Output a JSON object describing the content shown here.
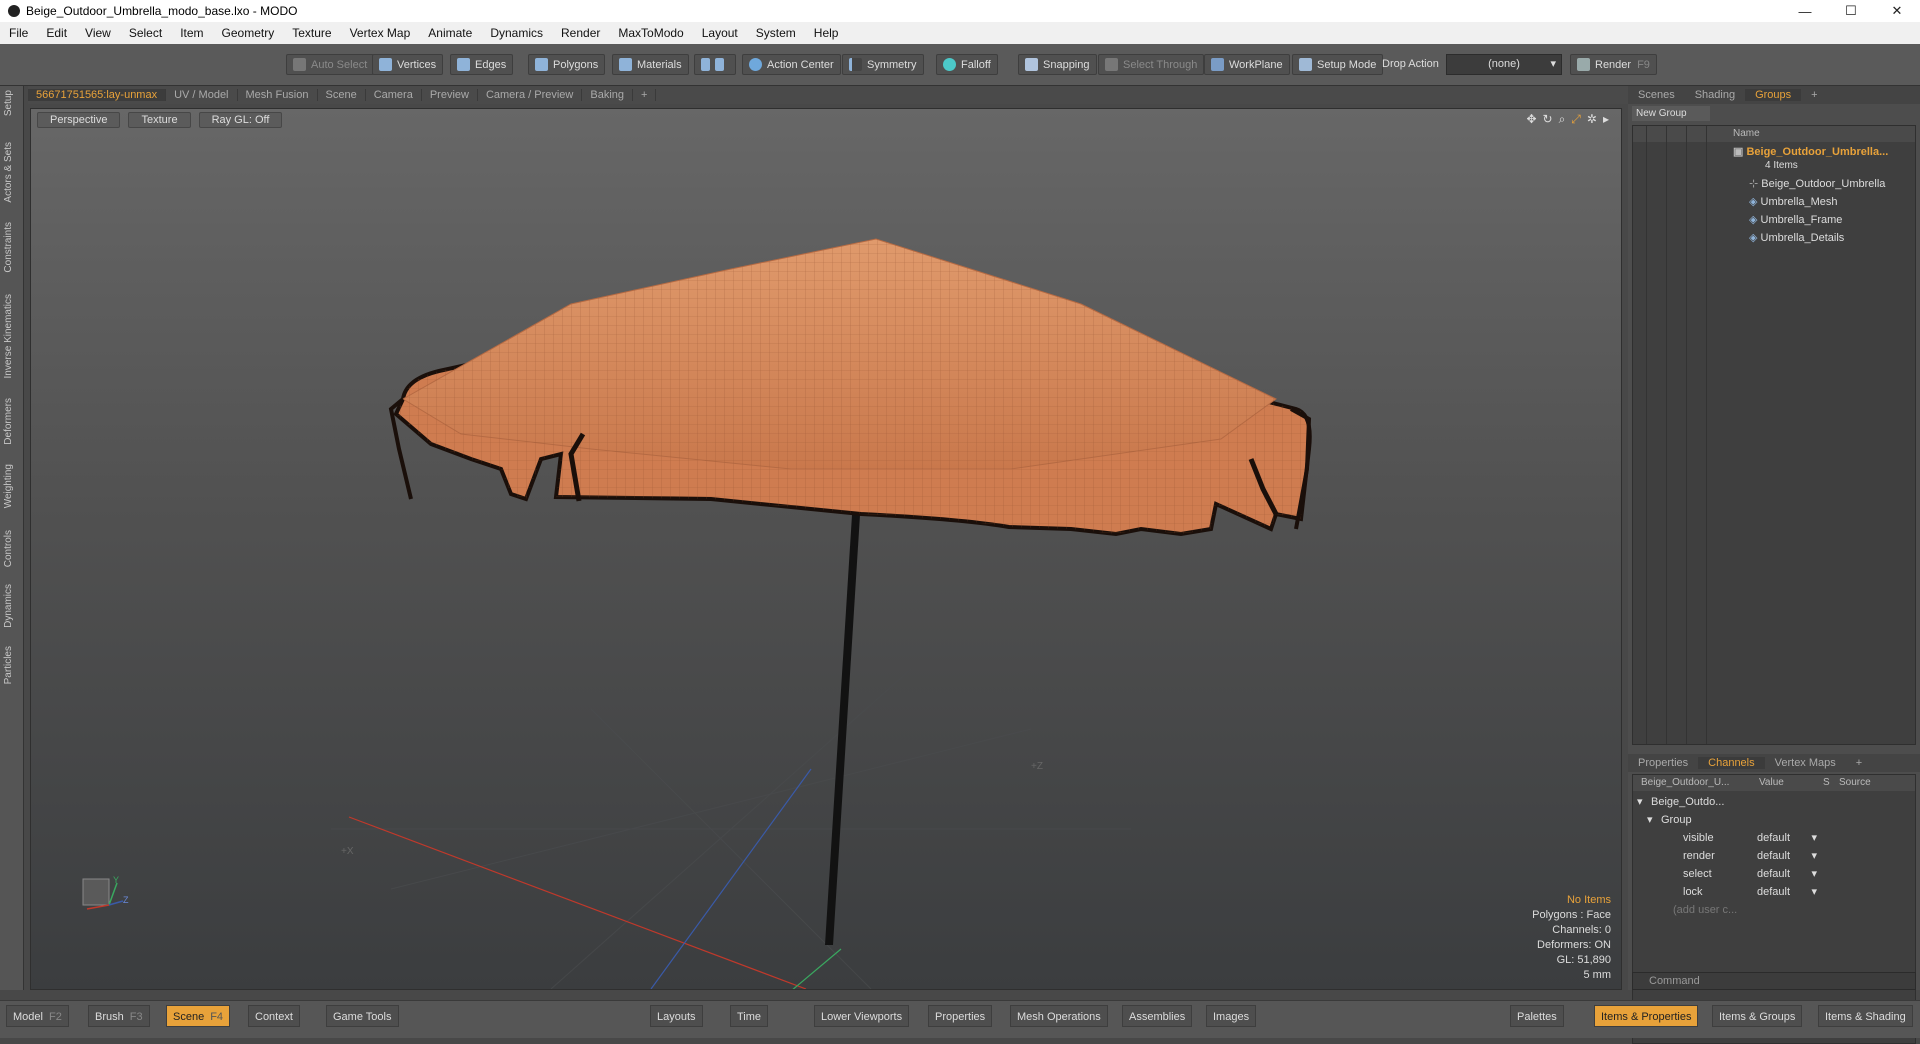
{
  "window": {
    "title": "Beige_Outdoor_Umbrella_modo_base.lxo - MODO",
    "min": "—",
    "max": "☐",
    "close": "✕"
  },
  "menu": [
    "File",
    "Edit",
    "View",
    "Select",
    "Item",
    "Geometry",
    "Texture",
    "Vertex Map",
    "Animate",
    "Dynamics",
    "Render",
    "MaxToModo",
    "Layout",
    "System",
    "Help"
  ],
  "toolbar": {
    "auto_select": "Auto Select",
    "vertices": "Vertices",
    "edges": "Edges",
    "polygons": "Polygons",
    "materials": "Materials",
    "action_center": "Action Center",
    "symmetry": "Symmetry",
    "falloff": "Falloff",
    "snapping": "Snapping",
    "select_through": "Select Through",
    "workplane": "WorkPlane",
    "setup_mode": "Setup Mode",
    "drop_action": "Drop Action",
    "drop_value": "(none)",
    "render": "Render",
    "render_key": "F9"
  },
  "left_tabs": [
    "Setup",
    "Actors & Sets",
    "Constraints",
    "Inverse Kinematics",
    "Deformers",
    "Weighting",
    "Controls",
    "Dynamics",
    "Particles"
  ],
  "viewport_tabs": [
    "56671751565:lay-unmax",
    "UV / Model",
    "Mesh Fusion",
    "Scene",
    "Camera",
    "Preview",
    "Camera / Preview",
    "Baking",
    "+"
  ],
  "viewport": {
    "view_mode": "Perspective",
    "shading": "Texture",
    "raygl": "Ray GL: Off",
    "axis_x": "+X",
    "axis_z": "+Z",
    "gizmo_y": "Y",
    "gizmo_z": "Z",
    "info": {
      "items": "No Items",
      "polygons": "Polygons : Face",
      "channels": "Channels: 0",
      "deformers": "Deformers: ON",
      "gl": "GL: 51,890",
      "unit": "5 mm"
    }
  },
  "scene_tabs": [
    "Scenes",
    "Shading",
    "Groups",
    "+"
  ],
  "groups": {
    "new_group": "New Group",
    "column_name": "Name",
    "root": "Beige_Outdoor_Umbrella...",
    "root_count": "4 Items",
    "children": [
      "Beige_Outdoor_Umbrella",
      "Umbrella_Mesh",
      "Umbrella_Frame",
      "Umbrella_Details"
    ]
  },
  "prop_tabs": [
    "Properties",
    "Channels",
    "Vertex Maps",
    "+"
  ],
  "channels": {
    "col_item": "Beige_Outdoor_U...",
    "col_value": "Value",
    "col_s": "S",
    "col_source": "Source",
    "item": "Beige_Outdo...",
    "group": "Group",
    "rows": [
      {
        "name": "visible",
        "value": "default"
      },
      {
        "name": "render",
        "value": "default"
      },
      {
        "name": "select",
        "value": "default"
      },
      {
        "name": "lock",
        "value": "default"
      }
    ],
    "add_user": "(add user c..."
  },
  "command_placeholder": "Command",
  "statusbar": {
    "model": "Model",
    "model_key": "F2",
    "brush": "Brush",
    "brush_key": "F3",
    "scene": "Scene",
    "scene_key": "F4",
    "context": "Context",
    "game_tools": "Game Tools",
    "layouts": "Layouts",
    "time": "Time",
    "lower_viewports": "Lower Viewports",
    "properties": "Properties",
    "mesh_operations": "Mesh Operations",
    "assemblies": "Assemblies",
    "images": "Images",
    "palettes": "Palettes",
    "items_properties": "Items & Properties",
    "items_groups": "Items & Groups",
    "items_shading": "Items & Shading"
  },
  "colors": {
    "accent": "#e8a23a",
    "canopy": "#d9865a",
    "pole": "#121212"
  }
}
